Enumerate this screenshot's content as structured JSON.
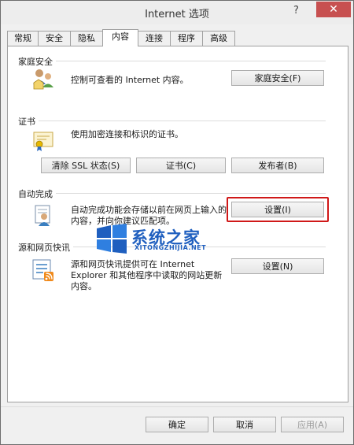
{
  "window": {
    "title": "Internet 选项",
    "help_label": "?",
    "close_label": "✕"
  },
  "tabs": [
    {
      "label": "常规"
    },
    {
      "label": "安全"
    },
    {
      "label": "隐私"
    },
    {
      "label": "内容"
    },
    {
      "label": "连接"
    },
    {
      "label": "程序"
    },
    {
      "label": "高级"
    }
  ],
  "active_tab": "内容",
  "family_safety": {
    "title": "家庭安全",
    "description": "控制可查看的 Internet 内容。",
    "button": "家庭安全(F)",
    "icon": "family-safety-icon"
  },
  "certificates": {
    "title": "证书",
    "description": "使用加密连接和标识的证书。",
    "buttons": {
      "clear_ssl": "清除 SSL 状态(S)",
      "certificates": "证书(C)",
      "publishers": "发布者(B)"
    },
    "icon": "certificate-icon"
  },
  "autocomplete": {
    "title": "自动完成",
    "description_line1": "自动完成功能会存储以前在网页上输入的",
    "description_line2": "内容，并向你建议匹配项。",
    "button": "设置(I)",
    "icon": "autocomplete-icon",
    "highlight_color": "#d01818"
  },
  "feeds": {
    "title": "源和网页快讯",
    "description_line1": "源和网页快讯提供可在 Internet",
    "description_line2": "Explorer 和其他程序中读取的网站更新",
    "description_line3": "内容。",
    "button": "设置(N)",
    "icon": "feeds-icon"
  },
  "footer": {
    "ok": "确定",
    "cancel": "取消",
    "apply": "应用(A)"
  },
  "watermark": {
    "text": "系统之家",
    "sub": "XITONGZHIJIA.NET",
    "color": "#1f5fbf"
  }
}
